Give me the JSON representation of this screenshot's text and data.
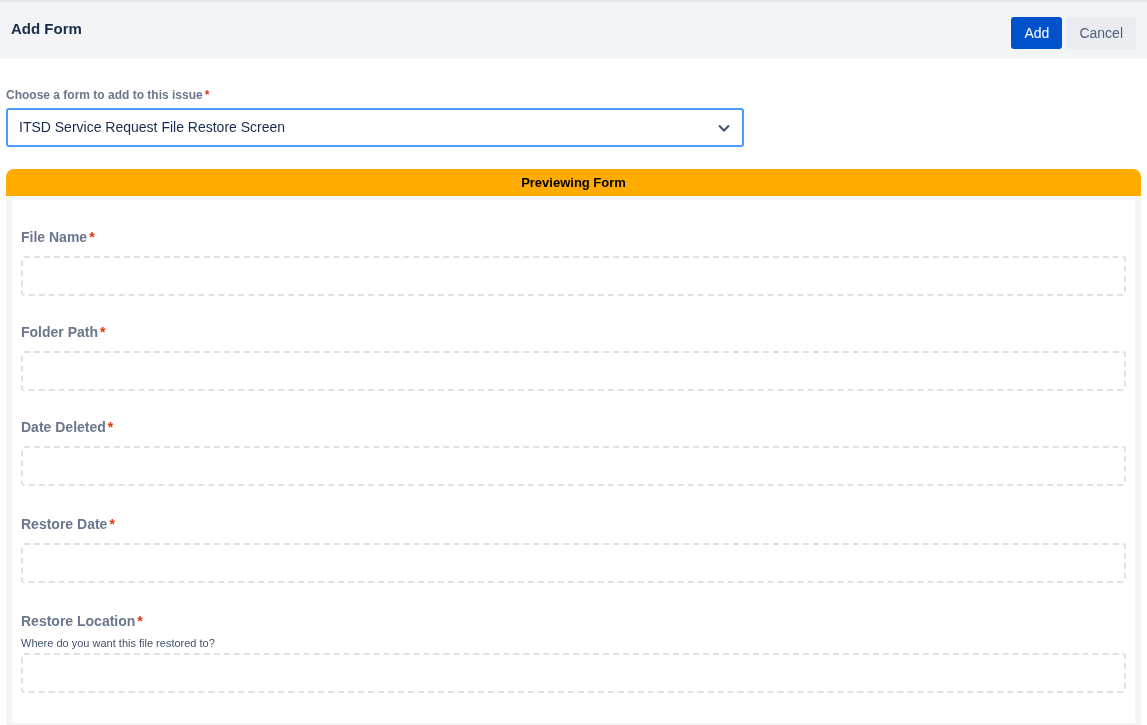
{
  "header": {
    "title": "Add Form",
    "buttons": [
      {
        "label": "Add",
        "kind": "primary"
      },
      {
        "label": "Cancel",
        "kind": "secondary"
      }
    ]
  },
  "form_select": {
    "label": "Choose a form to add to this issue",
    "required_mark": "*",
    "value": "ITSD Service Request File Restore Screen"
  },
  "preview": {
    "banner": "Previewing Form",
    "fields": [
      {
        "label": "File Name",
        "required_mark": "*"
      },
      {
        "label": "Folder Path",
        "required_mark": "*"
      },
      {
        "label": "Date Deleted",
        "required_mark": "*"
      },
      {
        "label": "Restore Date",
        "required_mark": "*"
      },
      {
        "label": "Restore Location",
        "required_mark": "*",
        "help": "Where do you want this file restored to?"
      }
    ]
  }
}
